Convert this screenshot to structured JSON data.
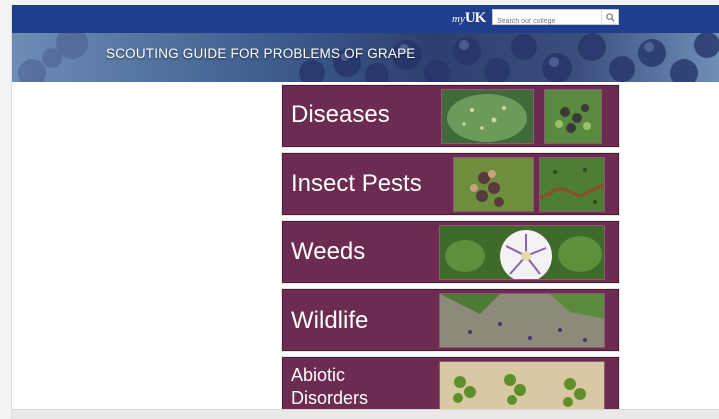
{
  "header": {
    "logo_text": "my",
    "logo_brand": "UK",
    "search": {
      "placeholder": "Search our college",
      "icon": "magnifier-icon"
    }
  },
  "banner": {
    "title": "SCOUTING GUIDE FOR PROBLEMS OF GRAPE"
  },
  "categories": [
    {
      "label": "Diseases"
    },
    {
      "label": "Insect Pests"
    },
    {
      "label": "Weeds"
    },
    {
      "label": "Wildlife"
    },
    {
      "label_line1": "Abiotic",
      "label_line2": "Disorders"
    }
  ],
  "colors": {
    "header_blue": "#1f3e8e",
    "category_maroon": "#6c2c52"
  }
}
